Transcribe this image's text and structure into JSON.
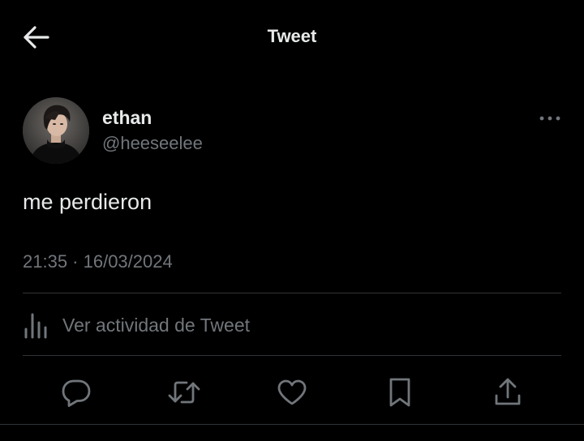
{
  "header": {
    "title": "Tweet",
    "back_icon": "arrow-left-icon"
  },
  "author": {
    "display_name": "ethan",
    "handle": "@heeseelee",
    "avatar_icon": "profile-photo",
    "more_icon": "more-horizontal-icon"
  },
  "tweet": {
    "text": "me perdieron",
    "timestamp": "21:35 · 16/03/2024"
  },
  "activity": {
    "label": "Ver actividad de Tweet",
    "icon": "analytics-bars-icon"
  },
  "actions": [
    {
      "name": "reply",
      "icon": "reply-icon"
    },
    {
      "name": "retweet",
      "icon": "retweet-icon"
    },
    {
      "name": "like",
      "icon": "heart-icon"
    },
    {
      "name": "bookmark",
      "icon": "bookmark-icon"
    },
    {
      "name": "share",
      "icon": "share-icon"
    }
  ],
  "colors": {
    "background": "#000000",
    "primary_text": "#e7e9ea",
    "secondary_text": "#71767b",
    "divider": "#2f3336"
  }
}
